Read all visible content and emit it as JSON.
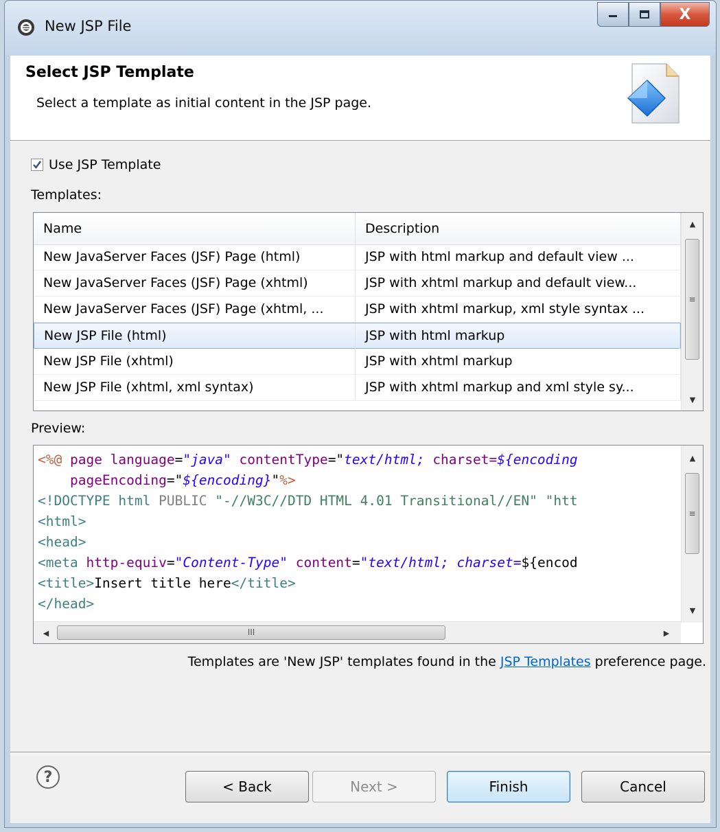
{
  "window": {
    "title": "New JSP File",
    "close_glyph": "X"
  },
  "banner": {
    "title": "Select JSP Template",
    "description": "Select a template as initial content in the JSP page."
  },
  "use_template": {
    "label": "Use JSP Template",
    "checked": true
  },
  "templates": {
    "label": "Templates:",
    "columns": [
      "Name",
      "Description"
    ],
    "rows": [
      {
        "name": "New JavaServer Faces (JSF) Page (html)",
        "description": "JSP with html markup and default view ..."
      },
      {
        "name": "New JavaServer Faces (JSF) Page (xhtml)",
        "description": "JSP with xhtml markup and default view..."
      },
      {
        "name": "New JavaServer Faces (JSF) Page (xhtml, ...",
        "description": "JSP with xhtml markup, xml style syntax ..."
      },
      {
        "name": "New JSP File (html)",
        "description": "JSP with html markup"
      },
      {
        "name": "New JSP File (xhtml)",
        "description": "JSP with xhtml markup"
      },
      {
        "name": "New JSP File (xhtml, xml syntax)",
        "description": "JSP with xhtml markup and xml style sy..."
      }
    ],
    "selected_index": 3
  },
  "preview": {
    "label": "Preview:",
    "lines": [
      [
        {
          "t": "<%@ ",
          "c": "dir"
        },
        {
          "t": "page ",
          "c": "attr"
        },
        {
          "t": "language",
          "c": "attr"
        },
        {
          "t": "=",
          "c": "text"
        },
        {
          "t": "\"java\"",
          "c": "val"
        },
        {
          "t": " ",
          "c": "text"
        },
        {
          "t": "contentType",
          "c": "attr"
        },
        {
          "t": "=\"",
          "c": "text"
        },
        {
          "t": "text/html; ",
          "c": "val"
        },
        {
          "t": "charset=",
          "c": "attr"
        },
        {
          "t": "${encoding",
          "c": "val"
        }
      ],
      [
        {
          "t": "    ",
          "c": "text"
        },
        {
          "t": "pageEncoding",
          "c": "attr"
        },
        {
          "t": "=\"",
          "c": "text"
        },
        {
          "t": "${encoding}",
          "c": "val"
        },
        {
          "t": "\"",
          "c": "text"
        },
        {
          "t": "%>",
          "c": "dir"
        }
      ],
      [
        {
          "t": "<!DOCTYPE ",
          "c": "tag"
        },
        {
          "t": "html ",
          "c": "tag"
        },
        {
          "t": "PUBLIC ",
          "c": "doc"
        },
        {
          "t": "\"-//W3C//DTD HTML 4.01 Transitional//EN\" \"htt",
          "c": "str"
        }
      ],
      [
        {
          "t": "<html>",
          "c": "tag"
        }
      ],
      [
        {
          "t": "<head>",
          "c": "tag"
        }
      ],
      [
        {
          "t": "<meta ",
          "c": "tag"
        },
        {
          "t": "http-equiv",
          "c": "attr"
        },
        {
          "t": "=",
          "c": "text"
        },
        {
          "t": "\"Content-Type\"",
          "c": "val"
        },
        {
          "t": " ",
          "c": "text"
        },
        {
          "t": "content",
          "c": "attr"
        },
        {
          "t": "=",
          "c": "text"
        },
        {
          "t": "\"text/html; charset=",
          "c": "val"
        },
        {
          "t": "${encod",
          "c": "text"
        }
      ],
      [
        {
          "t": "<title>",
          "c": "tag"
        },
        {
          "t": "Insert title here",
          "c": "text"
        },
        {
          "t": "</title>",
          "c": "tag"
        }
      ],
      [
        {
          "t": "</head>",
          "c": "tag"
        }
      ]
    ],
    "scroll_grip": "III"
  },
  "footer_note": {
    "before": "Templates are 'New JSP' templates found in the ",
    "link": "JSP Templates",
    "after": " preference page."
  },
  "buttons": {
    "help": "?",
    "back": "< Back",
    "next": "Next >",
    "finish": "Finish",
    "cancel": "Cancel"
  },
  "colors": {
    "selection_border": "#84acdd",
    "link": "#0066cc",
    "default_button": "#3c7fb1"
  }
}
